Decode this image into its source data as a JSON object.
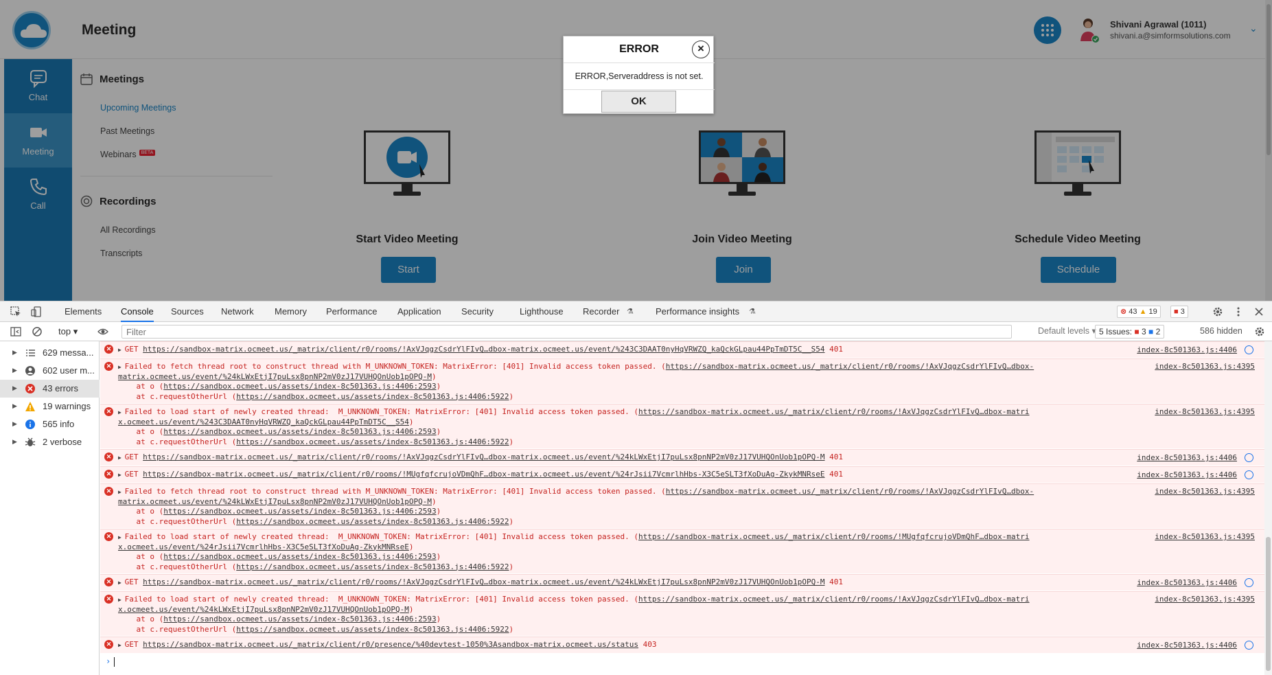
{
  "app": {
    "page_title": "Meeting",
    "user": {
      "name": "Shivani Agrawal (1011)",
      "email": "shivani.a@simformsolutions.com"
    },
    "nav": [
      {
        "label": "Chat",
        "icon": "chat-bubble-icon"
      },
      {
        "label": "Meeting",
        "icon": "video-camera-icon",
        "active": true
      },
      {
        "label": "Call",
        "icon": "phone-icon"
      }
    ],
    "meetings_section": {
      "title": "Meetings",
      "links": [
        "Upcoming Meetings",
        "Past Meetings",
        "Webinars"
      ],
      "beta_badge": "BETA"
    },
    "recordings_section": {
      "title": "Recordings",
      "links": [
        "All Recordings",
        "Transcripts"
      ]
    },
    "cards": [
      {
        "title": "Start Video Meeting",
        "button": "Start"
      },
      {
        "title": "Join Video Meeting",
        "button": "Join"
      },
      {
        "title": "Schedule Video Meeting",
        "button": "Schedule"
      }
    ],
    "accent_color": "#1a86c8"
  },
  "dialog": {
    "title": "ERROR",
    "close": "×",
    "message": "ERROR,Serveraddress is not set.",
    "ok": "OK"
  },
  "devtools": {
    "tabs": [
      "Elements",
      "Console",
      "Sources",
      "Network",
      "Memory",
      "Performance",
      "Application",
      "Security",
      "Lighthouse",
      "Recorder",
      "Performance insights"
    ],
    "active_tab": "Console",
    "counts": {
      "errors": "43",
      "warnings": "19",
      "issues": "3"
    },
    "toolbar": {
      "context": "top",
      "filter_placeholder": "Filter",
      "levels": "Default levels",
      "issues_label": "5 Issues:",
      "issues_errors": "3",
      "issues_info": "2",
      "hidden": "586 hidden"
    },
    "sidebar": [
      {
        "label": "629 messa...",
        "icon": "list-icon"
      },
      {
        "label": "602 user m...",
        "icon": "user-icon"
      },
      {
        "label": "43 errors",
        "icon": "error-icon",
        "selected": true
      },
      {
        "label": "19 warnings",
        "icon": "warning-icon"
      },
      {
        "label": "565 info",
        "icon": "info-icon"
      },
      {
        "label": "2 verbose",
        "icon": "bug-icon"
      }
    ],
    "messages": [
      {
        "lines": [
          {
            "pre": "GET ",
            "link": "https://sandbox-matrix.ocmeet.us/_matrix/client/r0/rooms/!AxVJqgzCsdrYlFIvQ…dbox-matrix.ocmeet.us/event/%243C3DAAT0nyHqVRWZQ_kaQckGLpau44PpTmDT5C__S54",
            "post": " 401"
          }
        ],
        "source": "index-8c501363.js:4406",
        "jump": true
      },
      {
        "lines": [
          {
            "pre": "Failed to fetch thread root to construct thread with M_UNKNOWN_TOKEN: MatrixError: [401] Invalid access token passed. (",
            "link": "https://sandbox-matrix.ocmeet.us/_matrix/client/r0/rooms/!AxVJqgzCsdrYlFIvQ…dbox-",
            "post": ""
          },
          {
            "pre": "",
            "link": "matrix.ocmeet.us/event/%24kLWxEtjI7puLsx8pnNP2mV0zJ17VUHQOnUob1pOPQ-M",
            "post": ")"
          },
          {
            "pre": "    at o (",
            "link": "https://sandbox.ocmeet.us/assets/index-8c501363.js:4406:2593",
            "post": ")"
          },
          {
            "pre": "    at c.requestOtherUrl (",
            "link": "https://sandbox.ocmeet.us/assets/index-8c501363.js:4406:5922",
            "post": ")"
          }
        ],
        "source": "index-8c501363.js:4395"
      },
      {
        "lines": [
          {
            "pre": "Failed to load start of newly created thread:  M_UNKNOWN_TOKEN: MatrixError: [401] Invalid access token passed. (",
            "link": "https://sandbox-matrix.ocmeet.us/_matrix/client/r0/rooms/!AxVJqgzCsdrYlFIvQ…dbox-matri",
            "post": ""
          },
          {
            "pre": "",
            "link": "x.ocmeet.us/event/%243C3DAAT0nyHqVRWZQ_kaQckGLpau44PpTmDT5C__S54",
            "post": ")"
          },
          {
            "pre": "    at o (",
            "link": "https://sandbox.ocmeet.us/assets/index-8c501363.js:4406:2593",
            "post": ")"
          },
          {
            "pre": "    at c.requestOtherUrl (",
            "link": "https://sandbox.ocmeet.us/assets/index-8c501363.js:4406:5922",
            "post": ")"
          }
        ],
        "source": "index-8c501363.js:4395"
      },
      {
        "lines": [
          {
            "pre": "GET ",
            "link": "https://sandbox-matrix.ocmeet.us/_matrix/client/r0/rooms/!AxVJqgzCsdrYlFIvQ…dbox-matrix.ocmeet.us/event/%24kLWxEtjI7puLsx8pnNP2mV0zJ17VUHQOnUob1pOPQ-M",
            "post": " 401"
          }
        ],
        "source": "index-8c501363.js:4406",
        "jump": true
      },
      {
        "lines": [
          {
            "pre": "GET ",
            "link": "https://sandbox-matrix.ocmeet.us/_matrix/client/r0/rooms/!MUgfqfcrujoVDmQhF…dbox-matrix.ocmeet.us/event/%24rJsii7VcmrlhHbs-X3C5eSLT3fXoDuAg-ZkykMNRseE",
            "post": " 401"
          }
        ],
        "source": "index-8c501363.js:4406",
        "jump": true
      },
      {
        "lines": [
          {
            "pre": "Failed to fetch thread root to construct thread with M_UNKNOWN_TOKEN: MatrixError: [401] Invalid access token passed. (",
            "link": "https://sandbox-matrix.ocmeet.us/_matrix/client/r0/rooms/!AxVJqgzCsdrYlFIvQ…dbox-",
            "post": ""
          },
          {
            "pre": "",
            "link": "matrix.ocmeet.us/event/%24kLWxEtjI7puLsx8pnNP2mV0zJ17VUHQOnUob1pOPQ-M",
            "post": ")"
          },
          {
            "pre": "    at o (",
            "link": "https://sandbox.ocmeet.us/assets/index-8c501363.js:4406:2593",
            "post": ")"
          },
          {
            "pre": "    at c.requestOtherUrl (",
            "link": "https://sandbox.ocmeet.us/assets/index-8c501363.js:4406:5922",
            "post": ")"
          }
        ],
        "source": "index-8c501363.js:4395"
      },
      {
        "lines": [
          {
            "pre": "Failed to load start of newly created thread:  M_UNKNOWN_TOKEN: MatrixError: [401] Invalid access token passed. (",
            "link": "https://sandbox-matrix.ocmeet.us/_matrix/client/r0/rooms/!MUgfqfcrujoVDmQhF…dbox-matri",
            "post": ""
          },
          {
            "pre": "",
            "link": "x.ocmeet.us/event/%24rJsii7VcmrlhHbs-X3C5eSLT3fXoDuAg-ZkykMNRseE",
            "post": ")"
          },
          {
            "pre": "    at o (",
            "link": "https://sandbox.ocmeet.us/assets/index-8c501363.js:4406:2593",
            "post": ")"
          },
          {
            "pre": "    at c.requestOtherUrl (",
            "link": "https://sandbox.ocmeet.us/assets/index-8c501363.js:4406:5922",
            "post": ")"
          }
        ],
        "source": "index-8c501363.js:4395"
      },
      {
        "lines": [
          {
            "pre": "GET ",
            "link": "https://sandbox-matrix.ocmeet.us/_matrix/client/r0/rooms/!AxVJqgzCsdrYlFIvQ…dbox-matrix.ocmeet.us/event/%24kLWxEtjI7puLsx8pnNP2mV0zJ17VUHQOnUob1pOPQ-M",
            "post": " 401"
          }
        ],
        "source": "index-8c501363.js:4406",
        "jump": true
      },
      {
        "lines": [
          {
            "pre": "Failed to load start of newly created thread:  M_UNKNOWN_TOKEN: MatrixError: [401] Invalid access token passed. (",
            "link": "https://sandbox-matrix.ocmeet.us/_matrix/client/r0/rooms/!AxVJqgzCsdrYlFIvQ…dbox-matri",
            "post": ""
          },
          {
            "pre": "",
            "link": "x.ocmeet.us/event/%24kLWxEtjI7puLsx8pnNP2mV0zJ17VUHQOnUob1pOPQ-M",
            "post": ")"
          },
          {
            "pre": "    at o (",
            "link": "https://sandbox.ocmeet.us/assets/index-8c501363.js:4406:2593",
            "post": ")"
          },
          {
            "pre": "    at c.requestOtherUrl (",
            "link": "https://sandbox.ocmeet.us/assets/index-8c501363.js:4406:5922",
            "post": ")"
          }
        ],
        "source": "index-8c501363.js:4395"
      },
      {
        "lines": [
          {
            "pre": "GET ",
            "link": "https://sandbox-matrix.ocmeet.us/_matrix/client/r0/presence/%40devtest-1050%3Asandbox-matrix.ocmeet.us/status",
            "post": " 403"
          }
        ],
        "source": "index-8c501363.js:4406",
        "jump": true
      }
    ],
    "prompt_symbol": "›"
  }
}
